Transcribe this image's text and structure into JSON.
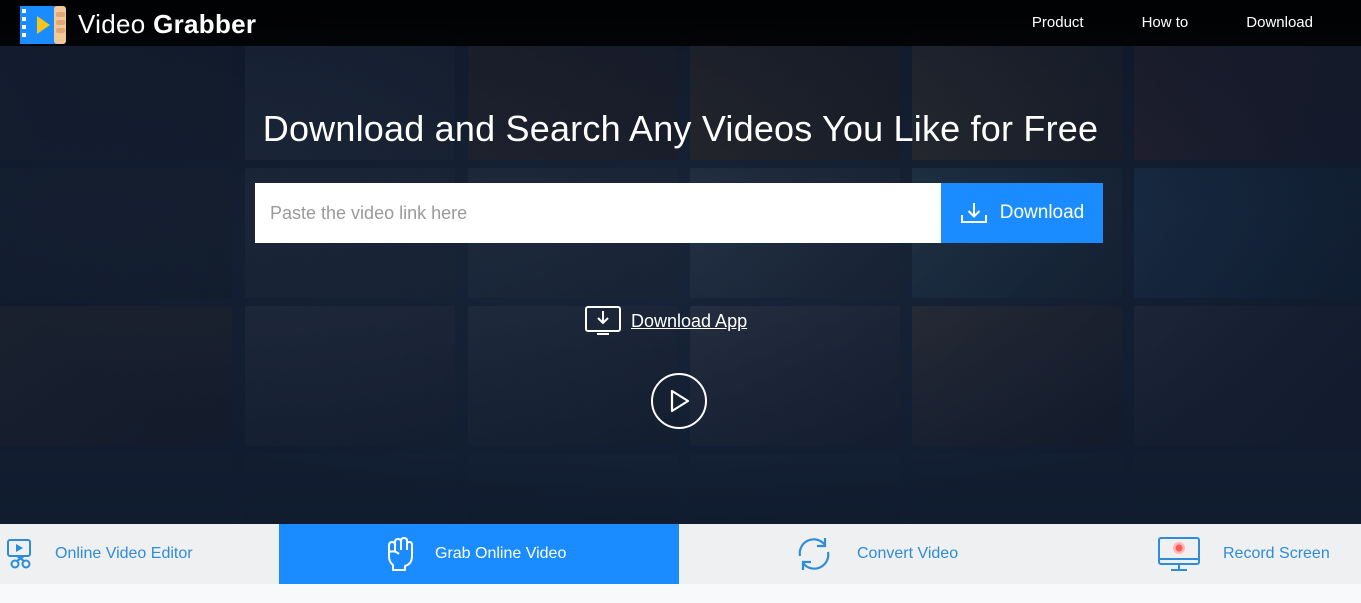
{
  "brand": {
    "name_light": "Video",
    "name_bold": "Grabber",
    "logo_icon": "film-strip-play-icon",
    "accent_color": "#1a8cff",
    "tab_text_color": "#2f8cd8"
  },
  "nav": {
    "items": [
      {
        "label": "Product"
      },
      {
        "label": "How to"
      },
      {
        "label": "Download"
      }
    ]
  },
  "hero": {
    "headline": "Download and Search Any Videos You Like for Free",
    "search": {
      "placeholder": "Paste the video link here",
      "value": ""
    },
    "download_button": {
      "label": "Download",
      "icon": "download-tray-icon"
    },
    "download_app": {
      "label": "Download App",
      "icon": "download-monitor-icon"
    },
    "play_icon": "play-circle-icon"
  },
  "tabs": [
    {
      "label": "Online Video Editor",
      "icon": "video-edit-icon",
      "active": false
    },
    {
      "label": "Grab Online Video",
      "icon": "fist-icon",
      "active": true
    },
    {
      "label": "Convert Video",
      "icon": "convert-arrows-icon",
      "active": false
    },
    {
      "label": "Record Screen",
      "icon": "record-screen-icon",
      "active": false
    }
  ]
}
